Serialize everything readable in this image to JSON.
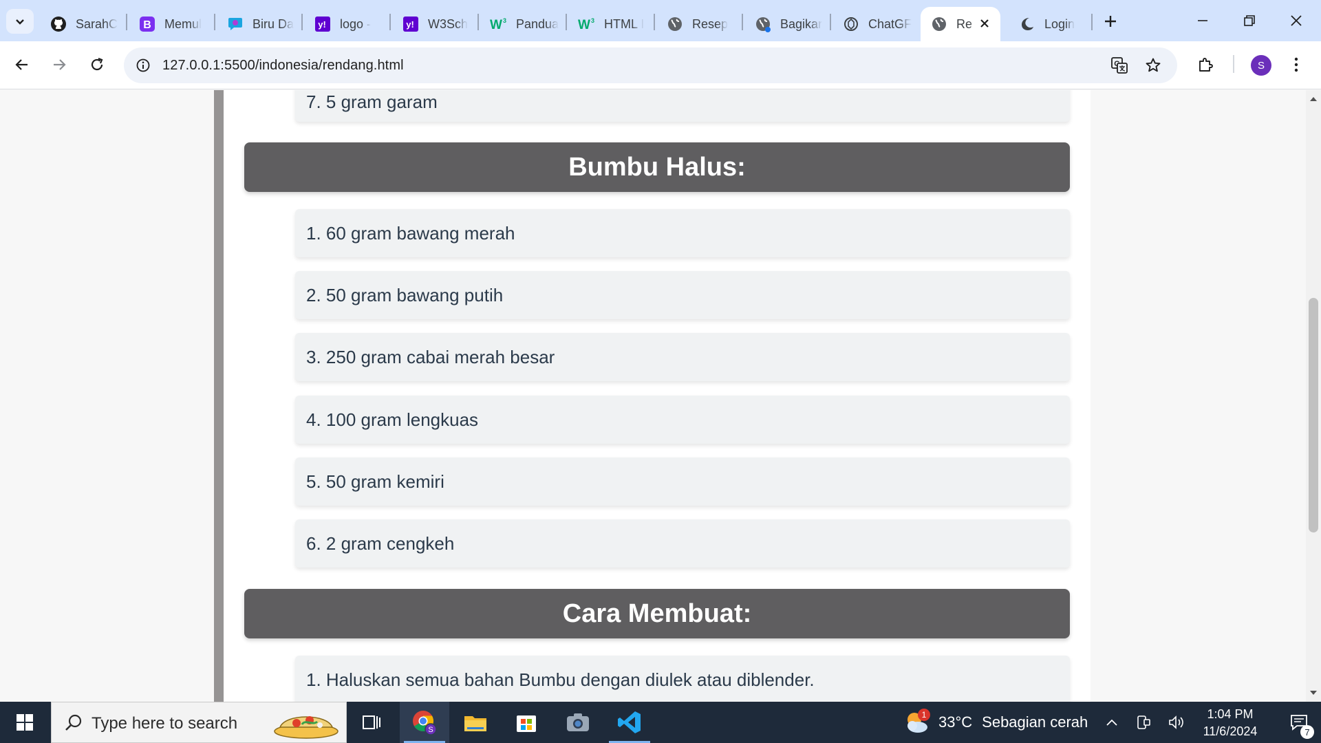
{
  "browser": {
    "tabs": [
      {
        "title": "SarahC",
        "icon": "github-icon"
      },
      {
        "title": "Memul",
        "icon": "bootstrap-icon"
      },
      {
        "title": "Biru Da",
        "icon": "canva-icon"
      },
      {
        "title": "logo - ",
        "icon": "yahoo-icon"
      },
      {
        "title": "W3Sch",
        "icon": "yahoo-icon"
      },
      {
        "title": "Pandua",
        "icon": "w3-icon"
      },
      {
        "title": "HTML I",
        "icon": "w3-icon"
      },
      {
        "title": "Resep ",
        "icon": "globe-icon"
      },
      {
        "title": "Bagikar",
        "icon": "globe-icon"
      },
      {
        "title": "ChatGF",
        "icon": "chatgpt-icon"
      },
      {
        "title": "Re",
        "icon": "globe-icon",
        "active": true
      },
      {
        "title": "Login",
        "icon": "moon-icon"
      }
    ],
    "url": "127.0.0.1:5500/indonesia/rendang.html",
    "profile_initial": "S"
  },
  "page": {
    "prev_item": "7. 5 gram garam",
    "bumbu_heading": "Bumbu Halus:",
    "bumbu_items": [
      "1. 60 gram bawang merah",
      "2. 50 gram bawang putih",
      "3. 250 gram cabai merah besar",
      "4. 100 gram lengkuas",
      "5. 50 gram kemiri",
      "6. 2 gram cengkeh"
    ],
    "cara_heading": "Cara Membuat:",
    "cara_items": [
      "1. Haluskan semua bahan Bumbu dengan diulek atau diblender."
    ]
  },
  "taskbar": {
    "search_placeholder": "Type here to search",
    "weather_temp": "33°C",
    "weather_desc": "Sebagian cerah",
    "weather_badge": "1",
    "time": "1:04 PM",
    "date": "11/6/2024",
    "notification_count": "7"
  },
  "colors": {
    "tabstrip": "#d3e3fd",
    "section_header": "#5f5e60",
    "item_bg": "#f0f2f3",
    "item_text": "#2b3a4a",
    "taskbar": "#1e2a3a"
  }
}
